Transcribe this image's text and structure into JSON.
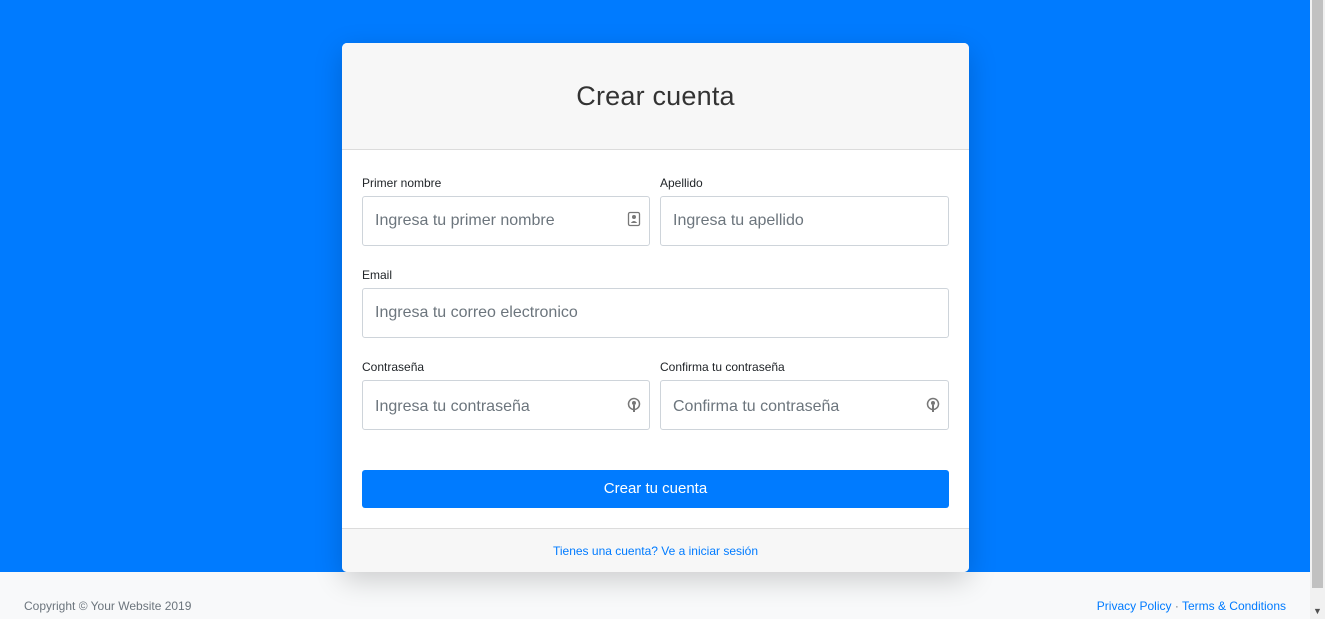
{
  "form": {
    "title": "Crear cuenta",
    "first_name": {
      "label": "Primer nombre",
      "placeholder": "Ingresa tu primer nombre"
    },
    "last_name": {
      "label": "Apellido",
      "placeholder": "Ingresa tu apellido"
    },
    "email": {
      "label": "Email",
      "placeholder": "Ingresa tu correo electronico"
    },
    "password": {
      "label": "Contraseña",
      "placeholder": "Ingresa tu contraseña"
    },
    "confirm_password": {
      "label": "Confirma tu contraseña",
      "placeholder": "Confirma tu contraseña"
    },
    "submit_label": "Crear tu cuenta",
    "login_link": "Tienes una cuenta? Ve a iniciar sesión"
  },
  "footer": {
    "copyright": "Copyright © Your Website 2019",
    "privacy": "Privacy Policy",
    "separator": "·",
    "terms": "Terms & Conditions"
  },
  "colors": {
    "primary": "#007bff",
    "footer_bg": "#f8f9fa",
    "card_header_bg": "#f7f7f7"
  },
  "icons": {
    "first_name_icon": "contact-card-icon",
    "password_icon": "key-icon",
    "confirm_password_icon": "key-icon"
  }
}
